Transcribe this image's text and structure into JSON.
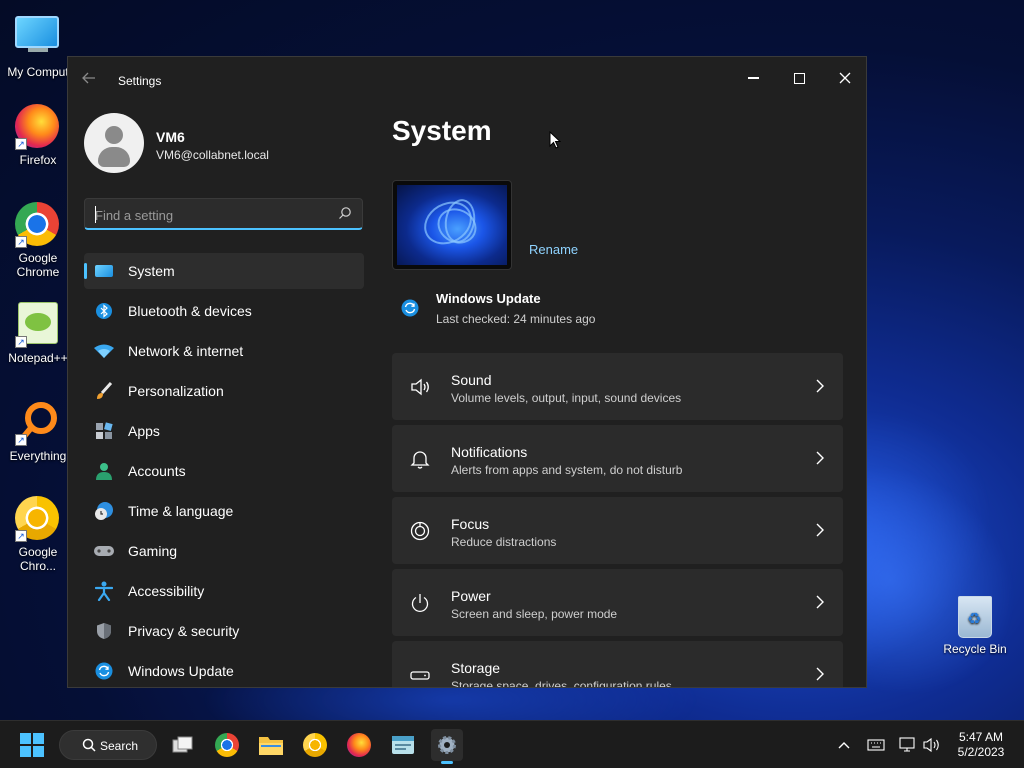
{
  "desktop": {
    "icons": [
      {
        "label": "My Comput",
        "icon": "monitor-icon"
      },
      {
        "label": "Firefox",
        "icon": "firefox-icon"
      },
      {
        "label": "Google Chrome",
        "icon": "chrome-icon"
      },
      {
        "label": "Notepad++",
        "icon": "notepad-plus-plus-icon"
      },
      {
        "label": "Everything",
        "icon": "everything-search-icon"
      },
      {
        "label": "Google Chro...",
        "icon": "chrome-canary-icon"
      }
    ],
    "recycle_bin": {
      "label": "Recycle Bin",
      "icon": "recycle-bin-icon"
    }
  },
  "window": {
    "title": "Settings",
    "controls": [
      "minimize",
      "maximize",
      "close"
    ]
  },
  "profile": {
    "name": "VM6",
    "email": "VM6@collabnet.local"
  },
  "search": {
    "placeholder": "Find a setting"
  },
  "nav": {
    "items": [
      {
        "label": "System",
        "icon": "system-display-icon",
        "active": true
      },
      {
        "label": "Bluetooth & devices",
        "icon": "bluetooth-icon"
      },
      {
        "label": "Network & internet",
        "icon": "wifi-icon"
      },
      {
        "label": "Personalization",
        "icon": "paintbrush-icon"
      },
      {
        "label": "Apps",
        "icon": "apps-icon"
      },
      {
        "label": "Accounts",
        "icon": "account-icon"
      },
      {
        "label": "Time & language",
        "icon": "clock-globe-icon"
      },
      {
        "label": "Gaming",
        "icon": "gamepad-icon"
      },
      {
        "label": "Accessibility",
        "icon": "accessibility-icon"
      },
      {
        "label": "Privacy & security",
        "icon": "shield-icon"
      },
      {
        "label": "Windows Update",
        "icon": "windows-update-icon"
      }
    ]
  },
  "main": {
    "title": "System",
    "rename_label": "Rename",
    "update": {
      "title": "Windows Update",
      "subtitle": "Last checked: 24 minutes ago"
    },
    "cards": [
      {
        "title": "Sound",
        "subtitle": "Volume levels, output, input, sound devices",
        "icon": "speaker-icon"
      },
      {
        "title": "Notifications",
        "subtitle": "Alerts from apps and system, do not disturb",
        "icon": "bell-icon"
      },
      {
        "title": "Focus",
        "subtitle": "Reduce distractions",
        "icon": "focus-icon"
      },
      {
        "title": "Power",
        "subtitle": "Screen and sleep, power mode",
        "icon": "power-icon"
      },
      {
        "title": "Storage",
        "subtitle": "Storage space, drives, configuration rules",
        "icon": "storage-icon"
      }
    ]
  },
  "taskbar": {
    "search_label": "Search",
    "apps": [
      "task-view-icon",
      "chrome-icon",
      "file-explorer-icon",
      "chrome-canary-icon",
      "firefox-icon",
      "notepad-plus-plus-icon",
      "settings-gear-icon"
    ],
    "clock": {
      "time": "5:47 AM",
      "date": "5/2/2023"
    }
  },
  "colors": {
    "accent": "#4cc2ff",
    "window_bg": "#202020",
    "card_bg": "#2b2b2b",
    "taskbar_bg": "#1c1c1c"
  }
}
